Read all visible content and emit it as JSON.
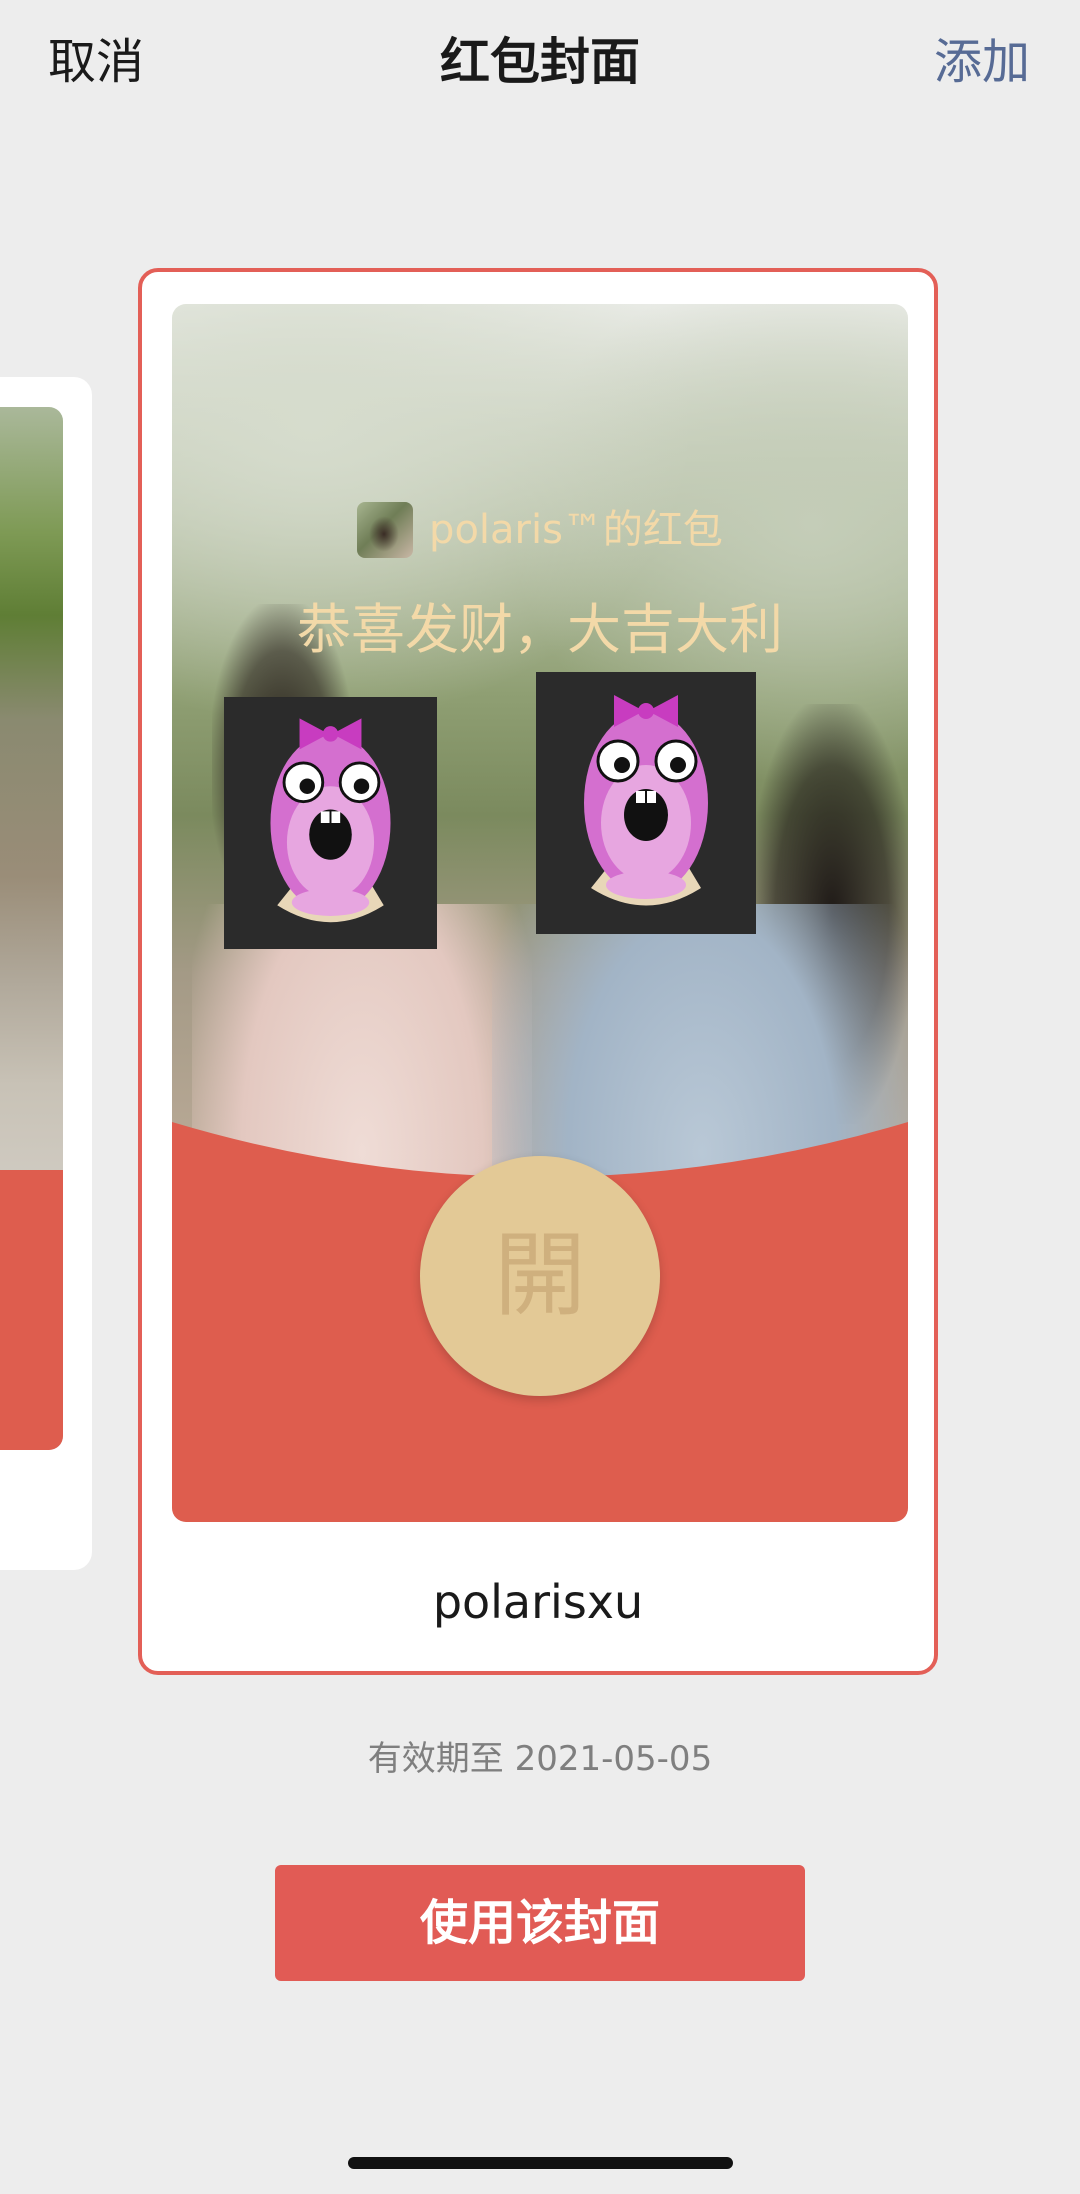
{
  "header": {
    "cancel_label": "取消",
    "title": "红包封面",
    "add_label": "添加",
    "add_color": "#576B95"
  },
  "cover": {
    "sender_label": "polaris™的红包",
    "greeting": "恭喜发财，大吉大利",
    "open_label": "開",
    "name": "polarisxu",
    "accent_color": "#DE5D4E",
    "gold_color": "#E3C996"
  },
  "validity": {
    "text": "有效期至 2021-05-05"
  },
  "actions": {
    "use_label": "使用该封面",
    "use_color": "#E15B55"
  }
}
